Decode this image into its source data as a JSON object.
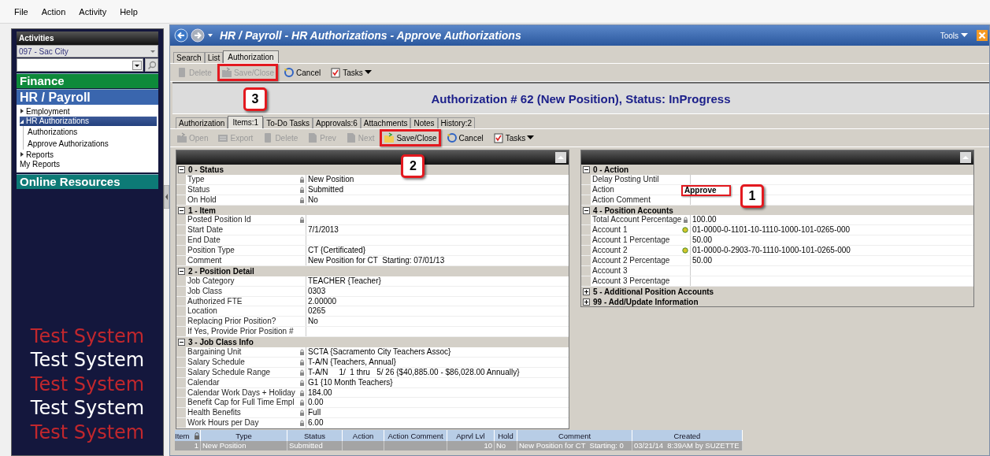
{
  "menu": [
    "File",
    "Action",
    "Activity",
    "Help"
  ],
  "sidebar": {
    "title": "Activities",
    "district": "097 - Sac City",
    "modules": [
      {
        "label": "Finance",
        "color": "#0e8a3a"
      },
      {
        "label": "HR / Payroll",
        "color": "#3a66ae",
        "items": [
          {
            "label": "Employment",
            "expanded": false,
            "selected": false
          },
          {
            "label": "HR Authorizations",
            "expanded": true,
            "selected": true,
            "children": [
              {
                "label": "Authorizations",
                "selected": false
              },
              {
                "label": "Approve Authorizations",
                "selected": false
              }
            ]
          },
          {
            "label": "Reports",
            "expanded": false,
            "selected": false
          },
          {
            "label": "My Reports",
            "selected": false
          }
        ]
      },
      {
        "label": "Online Resources",
        "color": "#0d7a76"
      }
    ],
    "test_banner": [
      {
        "text": "Test System",
        "color": "#c1272d"
      },
      {
        "text": "Test System",
        "color": "#ffffff"
      },
      {
        "text": "Test System",
        "color": "#c1272d"
      },
      {
        "text": "Test System",
        "color": "#ffffff"
      },
      {
        "text": "Test System",
        "color": "#c1272d"
      }
    ]
  },
  "window": {
    "title": "HR / Payroll - HR Authorizations - Approve Authorizations",
    "tools": "Tools"
  },
  "tabs": [
    {
      "label": "Search",
      "selected": false
    },
    {
      "label": "List",
      "selected": false
    },
    {
      "label": "Authorization",
      "selected": true
    }
  ],
  "toolbar": [
    {
      "kind": "delete",
      "label": "Delete",
      "disabled": true
    },
    {
      "kind": "save",
      "label": "Save/Close",
      "disabled": true,
      "annotation": {
        "number": "3"
      }
    },
    {
      "kind": "cancel",
      "label": "Cancel",
      "disabled": false
    },
    {
      "kind": "tasks",
      "label": "Tasks",
      "disabled": false
    }
  ],
  "heading": "Authorization # 62 (New Position), Status: InProgress",
  "detail_tabs": [
    {
      "label": "Authorization",
      "selected": false
    },
    {
      "label": "Items:1",
      "selected": true
    },
    {
      "label": "To-Do Tasks",
      "selected": false
    },
    {
      "label": "Approvals:6",
      "selected": false
    },
    {
      "label": "Attachments",
      "selected": false
    },
    {
      "label": "Notes",
      "selected": false
    },
    {
      "label": "History:2",
      "selected": false
    }
  ],
  "detail_toolbar": [
    {
      "kind": "open",
      "label": "Open",
      "disabled": true
    },
    {
      "kind": "export",
      "label": "Export",
      "disabled": true
    },
    {
      "kind": "delete",
      "label": "Delete",
      "disabled": true
    },
    {
      "kind": "prev",
      "label": "Prev",
      "disabled": true
    },
    {
      "kind": "next",
      "label": "Next",
      "disabled": true
    },
    {
      "kind": "save",
      "label": "Save/Close",
      "disabled": false,
      "annotation": {
        "number": "2"
      }
    },
    {
      "kind": "cancel",
      "label": "Cancel",
      "disabled": false
    },
    {
      "kind": "tasks",
      "label": "Tasks",
      "disabled": false
    }
  ],
  "left_grid": {
    "sections": [
      {
        "title": "0 - Status",
        "expanded": true,
        "rows": [
          {
            "label": "Type",
            "kind": "locked",
            "value": "New Position"
          },
          {
            "label": "Status",
            "kind": "locked",
            "value": "Submitted"
          },
          {
            "label": "On Hold",
            "kind": "locked",
            "value": "No"
          }
        ]
      },
      {
        "title": "1 - Item",
        "expanded": true,
        "rows": [
          {
            "label": "Posted Position Id",
            "kind": "locked"
          },
          {
            "label": "Start Date",
            "kind": "plain",
            "value": "7/1/2013"
          },
          {
            "label": "End Date",
            "kind": "plain"
          },
          {
            "label": "Position Type",
            "kind": "plain",
            "value": "CT {Certificated}"
          },
          {
            "label": "Comment",
            "kind": "plain",
            "value": "New Position for CT  Starting: 07/01/13"
          }
        ]
      },
      {
        "title": "2 - Position Detail",
        "expanded": true,
        "rows": [
          {
            "label": "Job Category",
            "kind": "plain",
            "value": "TEACHER {Teacher}"
          },
          {
            "label": "Job Class",
            "kind": "plain",
            "value": "0303"
          },
          {
            "label": "Authorized FTE",
            "kind": "plain",
            "value": "2.00000"
          },
          {
            "label": "Location",
            "kind": "plain",
            "value": "0265"
          },
          {
            "label": "Replacing Prior Position?",
            "kind": "plain",
            "value": "No"
          },
          {
            "label": "If Yes, Provide Prior Position #",
            "kind": "plain"
          }
        ]
      },
      {
        "title": "3 - Job Class Info",
        "expanded": true,
        "rows": [
          {
            "label": "Bargaining Unit",
            "kind": "locked",
            "value": "SCTA {Sacramento City Teachers Assoc}"
          },
          {
            "label": "Salary Schedule",
            "kind": "locked",
            "value": "T-A/N {Teachers, Annual}"
          },
          {
            "label": "Salary Schedule Range",
            "kind": "locked",
            "value": "T-A/N     1/  1 thru   5/ 26 {$40,885.00 - $86,028.00 Annually}"
          },
          {
            "label": "Calendar",
            "kind": "locked",
            "value": "G1 {10 Month Teachers}"
          },
          {
            "label": "Calendar Work Days + Holiday",
            "kind": "locked",
            "value": "184.00"
          },
          {
            "label": "Benefit Cap for Full Time Empl",
            "kind": "locked",
            "value": "0.00"
          },
          {
            "label": "Health Benefits",
            "kind": "locked",
            "value": "Full"
          },
          {
            "label": "Work Hours per Day",
            "kind": "locked",
            "value": "6.00"
          }
        ]
      }
    ]
  },
  "right_grid": {
    "sections": [
      {
        "title": "0 - Action",
        "expanded": true,
        "rows": [
          {
            "label": "Delay Posting Until",
            "kind": "plain"
          },
          {
            "label": "Action",
            "kind": "plain",
            "value": "Approve",
            "annotation": {
              "number": "1"
            }
          },
          {
            "label": "Action Comment",
            "kind": "plain"
          }
        ]
      },
      {
        "title": "4 - Position Accounts",
        "expanded": true,
        "rows": [
          {
            "label": "Total Account Percentage",
            "kind": "locked",
            "value": "100.00"
          },
          {
            "label": "Account 1",
            "kind": "lookup",
            "value": "01-0000-0-1101-10-1110-1000-101-0265-000"
          },
          {
            "label": "Account 1 Percentage",
            "kind": "plain",
            "value": "50.00"
          },
          {
            "label": "Account 2",
            "kind": "lookup",
            "value": "01-0000-0-2903-70-1110-1000-101-0265-000"
          },
          {
            "label": "Account 2 Percentage",
            "kind": "plain",
            "value": "50.00"
          },
          {
            "label": "Account 3",
            "kind": "plain"
          },
          {
            "label": "Account 3 Percentage",
            "kind": "plain"
          }
        ]
      },
      {
        "title": "5 - Additional Position Accounts",
        "expanded": false
      },
      {
        "title": "99 - Add/Update Information",
        "expanded": false
      }
    ]
  },
  "items_table": {
    "columns": [
      "Item",
      "Type",
      "Status",
      "Action",
      "Action Comment",
      "Aprvl Lvl",
      "Hold",
      "Comment",
      "Created"
    ],
    "rows": [
      {
        "selected": true,
        "cells": [
          "1",
          "New Position",
          "Submitted",
          null,
          null,
          "10",
          "No",
          "New Position for CT  Starting: 0",
          "03/21/14  8:39AM by SUZETTE"
        ]
      }
    ]
  }
}
